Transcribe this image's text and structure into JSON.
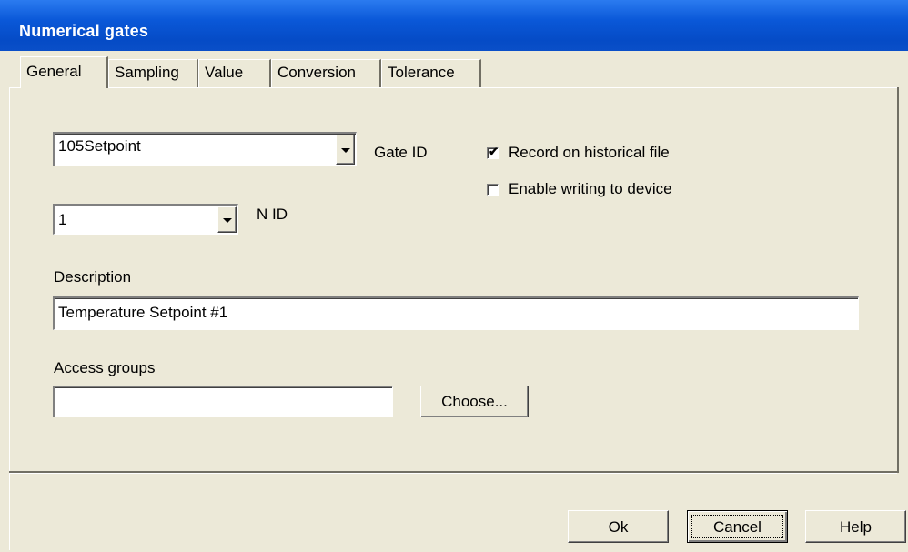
{
  "window": {
    "title": "Numerical gates"
  },
  "tabs": [
    {
      "label": "General"
    },
    {
      "label": "Sampling"
    },
    {
      "label": "Value"
    },
    {
      "label": "Conversion"
    },
    {
      "label": "Tolerance"
    }
  ],
  "general": {
    "gate_id": {
      "value": "105Setpoint",
      "label": "Gate ID"
    },
    "n_id": {
      "value": "1",
      "label": "N ID"
    },
    "record_historical": {
      "label": "Record on historical file",
      "checked": true
    },
    "enable_writing": {
      "label": "Enable writing to device",
      "checked": false
    },
    "description": {
      "label": "Description",
      "value": "Temperature Setpoint #1"
    },
    "access_groups": {
      "label": "Access groups",
      "value": "",
      "choose_label": "Choose..."
    }
  },
  "buttons": {
    "ok": "Ok",
    "cancel": "Cancel",
    "help": "Help"
  },
  "colors": {
    "titlebar": "#0a58d8",
    "face": "#ece9d8"
  },
  "icons": {
    "dropdown": "chevron-down-icon",
    "checkmark": "checkmark-icon"
  }
}
